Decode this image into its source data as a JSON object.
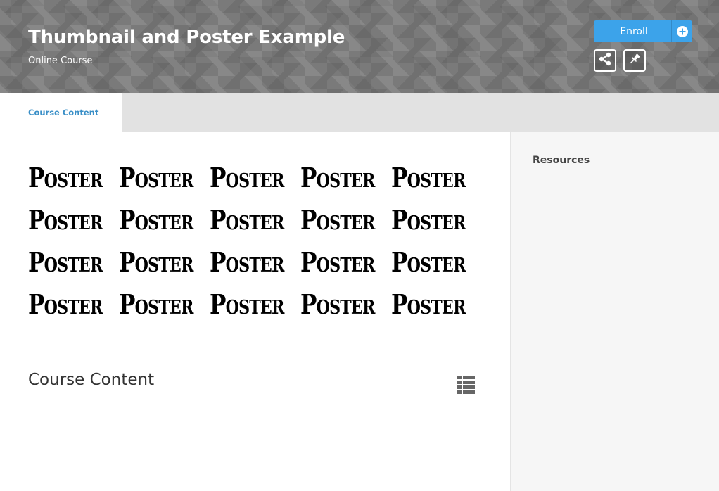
{
  "header": {
    "title": "Thumbnail and Poster Example",
    "subtitle": "Online Course",
    "enroll_label": "Enroll",
    "enroll_icon": "plus-circle-icon",
    "share_icon": "share-icon",
    "pin_icon": "pushpin-icon"
  },
  "tabs": [
    {
      "label": "Course Content",
      "active": true
    }
  ],
  "main": {
    "poster_rows": [
      [
        "Poster",
        "Poster",
        "Poster",
        "Poster",
        "Poster"
      ],
      [
        "Poster",
        "Poster",
        "Poster",
        "Poster",
        "Poster"
      ],
      [
        "Poster",
        "Poster",
        "Poster",
        "Poster",
        "Poster"
      ],
      [
        "Poster",
        "Poster",
        "Poster",
        "Poster",
        "Poster"
      ]
    ],
    "section_title": "Course Content",
    "list_icon": "list-view-icon"
  },
  "sidebar": {
    "title": "Resources"
  },
  "colors": {
    "accent": "#3ca3ea",
    "tab_text": "#3a8fc7",
    "header_bg": "#7a7a7a"
  }
}
